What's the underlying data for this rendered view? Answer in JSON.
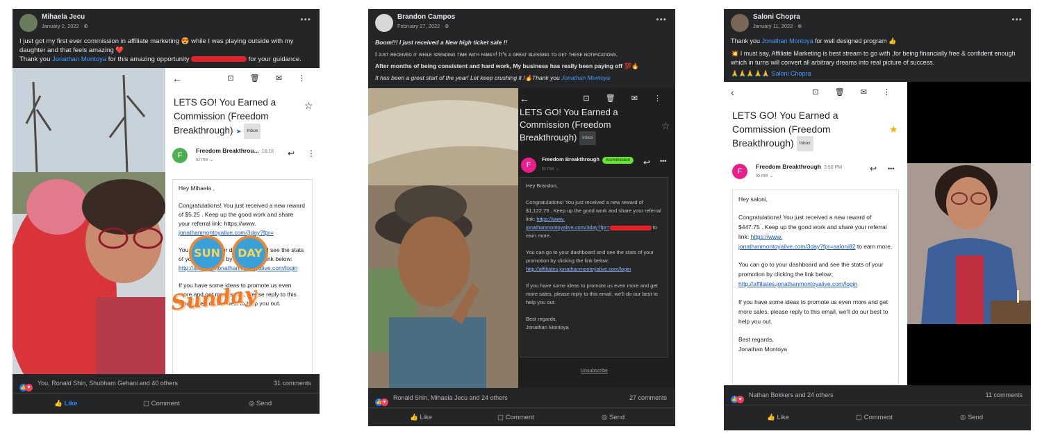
{
  "posts": [
    {
      "author": "Mihaela Jecu",
      "date": "January 2, 2022 · ",
      "text_line1": "I just got my first ever commission in affiliate marketing 😍 while I was playing outside with my daughter and that feels amazing ❤️",
      "text_line2_pre": "Thank you ",
      "text_line2_link": "Jonathan Montoya",
      "text_line2_mid": " for this amazing opportunity ",
      "text_line2_post": " for your guidance.",
      "email": {
        "subject": "LETS GO! You Earned a Commission (Freedom Breakthrough)",
        "inbox": "Inbox",
        "sender": "Freedom Breakthrou...",
        "time": "16:16",
        "to": "to me ⌄",
        "greeting": "Hey Mihaela ,",
        "para1": "Congratulations! You just received a new reward of $5.25 . Keep up the good work and share your referral link: https://www.",
        "para1_link": "jonathanmontoyalive.com/3day?fpr=",
        "para2": "You can go to your dashboard and see the stats of your promotion by clicking the link below:",
        "para2_link": "http://affiliates.jonathanmontoyalive.com/login",
        "para3": "If you have some ideas to promote us even more and get more sales, please reply to this email, we'll do our best to help you out."
      },
      "sticker_left": "SUN",
      "sticker_right": "DAY",
      "sticker_script": "Sunday",
      "reactions": "You, Ronald Shin, Shubham Gehani and 40 others",
      "comments": "31 comments",
      "actions": [
        "Like",
        "Comment",
        "Send"
      ]
    },
    {
      "author": "Brandon Campos",
      "date": "February 27, 2022 · ",
      "text_line1": "Boom!!! I just received a New high ticket sale !!",
      "text_line2": "I just received it while spending time with family! It's a great blessing to get these notifications.",
      "text_line3": "After months of being consistent and hard work,  My business has really been paying off 💯🔥",
      "text_line4_pre": "It has been a great start of the year! Let keep crushing it !🔥Thank you ",
      "text_line4_link": "Jonathan Montoya",
      "email": {
        "subject": "LETS GO! You Earned a Commission (Freedom Breakthrough)",
        "inbox": "Inbox",
        "sender": "Freedom Breakthrough",
        "tag": "#commission",
        "to": "to me ⌄",
        "greeting": "Hey Brandon,",
        "para1": "Congratulations! You just received a new reward of $1,122.75 . Keep up the good work and share your referral link: ",
        "para1_link1": "https://www.",
        "para1_link2": "jonathanmontoyalive.com/3day?fpr=",
        "para1_post": " to earn more.",
        "para2": "You can go to your dashboard and see the stats of your promotion by clicking the link below:",
        "para2_link": "http://affiliates.jonathanmontoyalive.com/login",
        "para3": "If you have some ideas to promote us even more and get more sales, please reply to this email, we'll do our best to help you out.",
        "signoff1": "Best regards,",
        "signoff2": "Jonathan Montoya",
        "unsubscribe": "Unsubscribe"
      },
      "reactions": "Ronald Shin, Mihaela Jecu and 24 others",
      "comments": "27 comments",
      "actions": [
        "Like",
        "Comment",
        "Send"
      ]
    },
    {
      "author": "Saloni Chopra",
      "date": "January 11, 2022 · ",
      "text_line1_pre": "Thank you ",
      "text_line1_link": "Jonathan Montoya",
      "text_line1_post": " for well designed program 👍",
      "text_line2": "💥 I must say, Affiliate Marketing is best stream to go with ,for being financially free & confident enough which in turns will convert  all arbitrary dreams into real picture of success.",
      "text_line3_pre": "🙏🙏🙏🙏🙏 ",
      "text_line3_link": "Saloni Chopra",
      "email": {
        "subject": "LETS GO! You Earned a Commission (Freedom Breakthrough)",
        "inbox": "Inbox",
        "sender": "Freedom Breakthrough",
        "time": "3:58 PM",
        "to": "to me ⌄",
        "greeting": "Hey saloni,",
        "para1": "Congratulations! You just received a new reward of $447.75 . Keep up the good work and share your referral link: ",
        "para1_link1": "https://www.",
        "para1_link2": "jonathanmontoyalive.com/3day?fpr=saloni82",
        "para1_post": " to earn more.",
        "para2": "You can go to your dashboard and see the stats of your promotion by clicking the link below:",
        "para2_link": "http://affiliates.jonathanmontoyalive.com/login",
        "para3": "If you have some ideas to promote us even more and get more sales, please reply to this email, we'll do our best to help you out.",
        "signoff1": "Best regards,",
        "signoff2": "Jonathan Montoya"
      },
      "reactions": "Nathan Bokkers and 24 others",
      "comments": "11 comments",
      "actions": [
        "Like",
        "Comment",
        "Send"
      ]
    }
  ],
  "icons": {
    "back": "←",
    "more": "•••",
    "toolbar": "⊡ 🗑 ✉ ⋮",
    "star": "☆",
    "star_filled": "★",
    "reply": "↩",
    "like": "👍",
    "comment": "💬",
    "send": "➤",
    "sender_initial": "F"
  },
  "colors": {
    "fb_dark": "#242526",
    "link": "#4599ff",
    "like_active": "#2d88ff",
    "gmail_green_avatar": "#4caf50",
    "gmail_pink_avatar": "#e91e8c"
  }
}
